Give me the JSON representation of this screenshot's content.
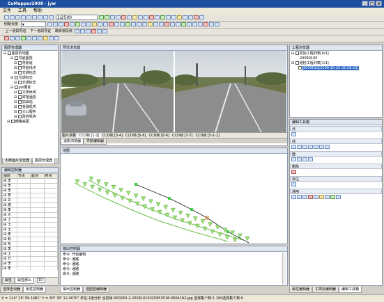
{
  "title": "CoMapper2008 - jyw",
  "menu": [
    "文件",
    "工具",
    "帮助"
  ],
  "toolbar": {
    "coord_value": "1/2500",
    "style_label": "例题长度"
  },
  "nav_toolbar": {
    "prev_frame": "上一道段导证",
    "next_frame": "下一道段导证",
    "jump_frame": "跳转道段帧"
  },
  "layer_panel": {
    "title": "图层管理器",
    "root": "图层的地图",
    "items": [
      {
        "label": "导航图层",
        "indent": 2,
        "check": true
      },
      {
        "label": "导航道",
        "indent": 3,
        "check": true
      },
      {
        "label": "导航线点",
        "indent": 3,
        "check": true
      },
      {
        "label": "交通标志",
        "indent": 3,
        "check": true
      },
      {
        "label": "交通标志",
        "indent": 2,
        "check": true
      },
      {
        "label": "交通标志",
        "indent": 3,
        "check": true
      },
      {
        "label": "poi要素",
        "indent": 2,
        "check": true
      },
      {
        "label": "文体休闲",
        "indent": 3,
        "check": true
      },
      {
        "label": "宾馆酒店",
        "indent": 3,
        "check": true
      },
      {
        "label": "加油站",
        "indent": 3,
        "check": true
      },
      {
        "label": "金融机构",
        "indent": 3,
        "check": true
      },
      {
        "label": "大公服务",
        "indent": 3,
        "check": true
      },
      {
        "label": "政府机构",
        "indent": 3,
        "check": true
      },
      {
        "label": "栅格底图",
        "indent": 1,
        "check": false
      }
    ],
    "tabs": [
      "大断面片浏览器",
      "图层管理器"
    ]
  },
  "edit_control": {
    "title": "编辑控制器",
    "columns": [
      "图层",
      "节点",
      "起点",
      "终点"
    ],
    "rows": [
      "李",
      "李",
      "李",
      "李",
      "文",
      "德",
      "李",
      "大",
      "土",
      "土",
      "土",
      "李",
      "有",
      "专",
      "李",
      "土",
      "方",
      "李",
      "李",
      "李"
    ],
    "tabs": [
      "属性",
      "属性那么"
    ],
    "footer": "10"
  },
  "preview": {
    "title": "预览浏览器",
    "cams": [
      "图片测量",
      "CCD帧 [1-2]",
      "CCD帧 [3-4]",
      "CCD帧 [5-6]",
      "CCD帧 [6-6]",
      "CCD帧 [7-7]",
      "CCD帧 [5-1-1]"
    ],
    "tabs": [
      "道影浏览器",
      "导航编辑器"
    ]
  },
  "map": {
    "title": "地图"
  },
  "output": {
    "title": "输出控制器",
    "lines": [
      "命令: 开始编辑",
      "命令: 通路",
      "命令: 通路",
      "命令: 通路",
      "命令: 通路"
    ]
  },
  "project": {
    "title": "工程浏览器",
    "root": "原始工程列表[0/1]",
    "sub": "20090105",
    "node": "道检工程列表[1/1]",
    "selected": "2009010[2009-10-25 02:58:53]"
  },
  "tools": {
    "title": "编辑工具箱",
    "sections": [
      "点",
      "线",
      "面",
      "删除",
      "标注",
      "通用"
    ]
  },
  "bottom_tabs_left": [
    "选择查询器",
    "属性控制器",
    "输出控制器",
    "选图查编辑器"
  ],
  "bottom_tabs_right": [
    "属性编辑器",
    "子类别编辑器",
    "编辑工具箱"
  ],
  "status": "X = 114° 26' 59.1481\"  Y = 30° 30' 12.4070\"  单位:1度分秒 当前帧:000263-2-20091015025853518-0004192.jpg 选择集个数:1 100选择集个数:0"
}
